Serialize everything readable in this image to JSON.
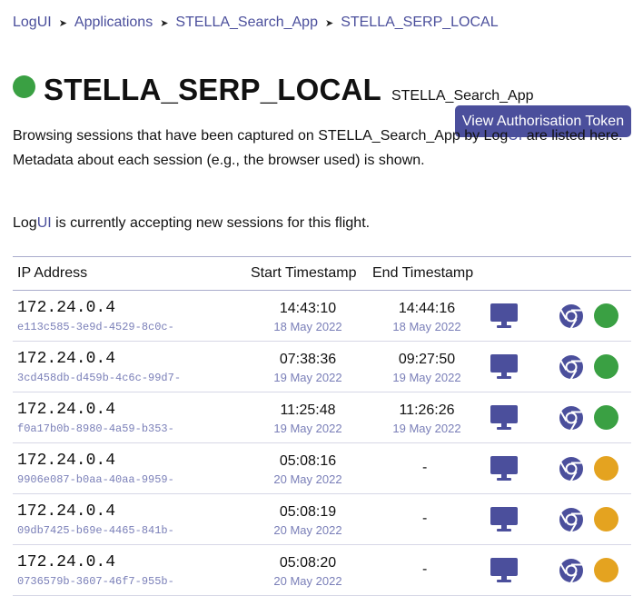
{
  "breadcrumb": [
    "LogUI",
    "Applications",
    "STELLA_Search_App",
    "STELLA_SERP_LOCAL"
  ],
  "page": {
    "title": "STELLA_SERP_LOCAL",
    "app_name": "STELLA_Search_App",
    "status_color": "#3aa043",
    "token_button": "View Authorisation Token"
  },
  "description": {
    "part1": "Browsing sessions that have been captured on STELLA_Search_App by Log",
    "part2": "UI",
    "part3": " are listed here. Metadata about each session (e.g., the browser used) is shown."
  },
  "accepting": {
    "part1": "Log",
    "part2": "UI",
    "part3": " is currently accepting new sessions for this flight."
  },
  "table": {
    "headers": {
      "ip": "IP Address",
      "start": "Start Timestamp",
      "end": "End Timestamp"
    },
    "rows": [
      {
        "ip": "172.24.0.4",
        "session_id": "e113c585-3e9d-4529-8c0c-",
        "start_time": "14:43:10",
        "start_date": "18 May 2022",
        "end_time": "14:44:16",
        "end_date": "18 May 2022",
        "state": "complete"
      },
      {
        "ip": "172.24.0.4",
        "session_id": "3cd458db-d459b-4c6c-99d7-",
        "start_time": "07:38:36",
        "start_date": "19 May 2022",
        "end_time": "09:27:50",
        "end_date": "19 May 2022",
        "state": "complete"
      },
      {
        "ip": "172.24.0.4",
        "session_id": "f0a17b0b-8980-4a59-b353-",
        "start_time": "11:25:48",
        "start_date": "19 May 2022",
        "end_time": "11:26:26",
        "end_date": "19 May 2022",
        "state": "complete"
      },
      {
        "ip": "172.24.0.4",
        "session_id": "9906e087-b0aa-40aa-9959-",
        "start_time": "05:08:16",
        "start_date": "20 May 2022",
        "end_time": "-",
        "end_date": "",
        "state": "active"
      },
      {
        "ip": "172.24.0.4",
        "session_id": "09db7425-b69e-4465-841b-",
        "start_time": "05:08:19",
        "start_date": "20 May 2022",
        "end_time": "-",
        "end_date": "",
        "state": "active"
      },
      {
        "ip": "172.24.0.4",
        "session_id": "0736579b-3607-46f7-955b-",
        "start_time": "05:08:20",
        "start_date": "20 May 2022",
        "end_time": "-",
        "end_date": "",
        "state": "active"
      }
    ]
  },
  "colors": {
    "accent": "#4b4f9c",
    "complete": "#3aa043",
    "active": "#e4a320"
  },
  "icons": {
    "device": "desktop-icon",
    "browser": "chrome-icon"
  }
}
